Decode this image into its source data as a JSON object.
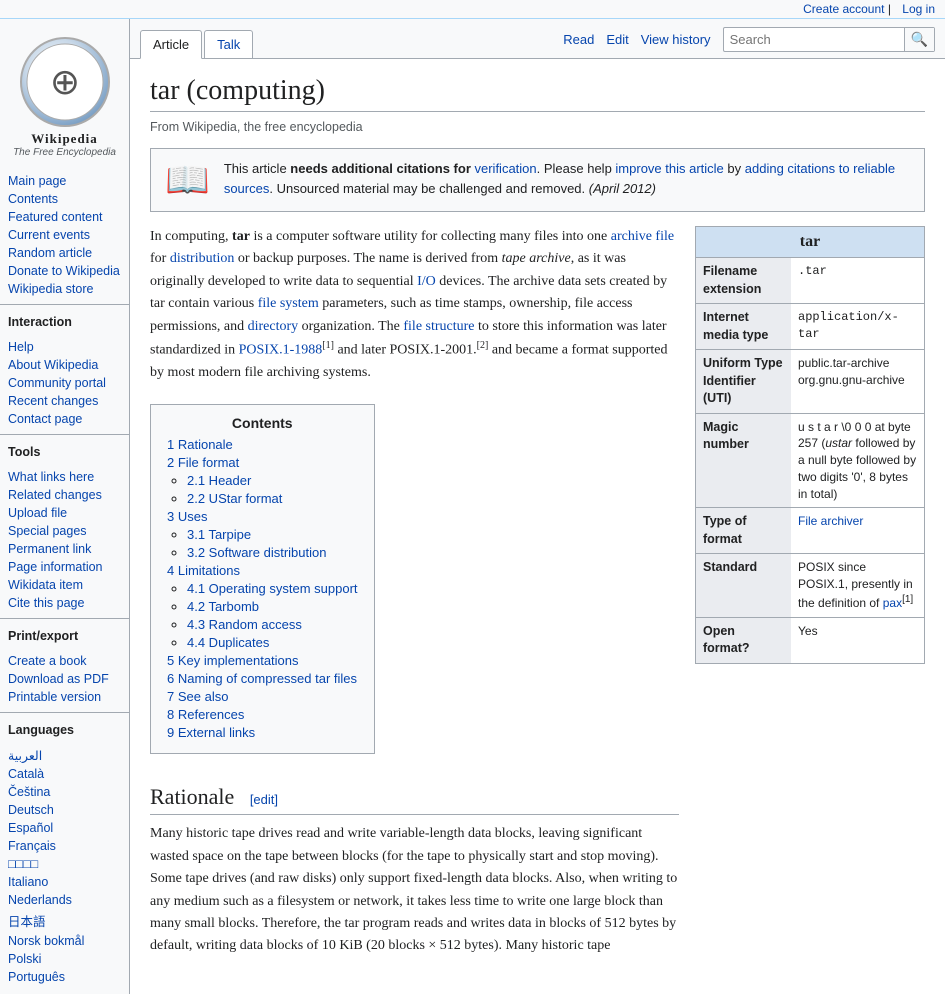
{
  "topbar": {
    "create_account": "Create account",
    "log_in": "Log in"
  },
  "logo": {
    "title": "Wikipedia",
    "subtitle": "The Free Encyclopedia",
    "icon": "🌐"
  },
  "sidebar": {
    "nav_items": [
      {
        "id": "main-page",
        "label": "Main page"
      },
      {
        "id": "contents",
        "label": "Contents"
      },
      {
        "id": "featured-content",
        "label": "Featured content"
      },
      {
        "id": "current-events",
        "label": "Current events"
      },
      {
        "id": "random-article",
        "label": "Random article"
      },
      {
        "id": "donate",
        "label": "Donate to Wikipedia"
      },
      {
        "id": "wikipedia-store",
        "label": "Wikipedia store"
      }
    ],
    "interaction_heading": "Interaction",
    "interaction_items": [
      {
        "id": "help",
        "label": "Help"
      },
      {
        "id": "about",
        "label": "About Wikipedia"
      },
      {
        "id": "community",
        "label": "Community portal"
      },
      {
        "id": "recent-changes",
        "label": "Recent changes"
      },
      {
        "id": "contact",
        "label": "Contact page"
      }
    ],
    "tools_heading": "Tools",
    "tools_items": [
      {
        "id": "what-links-here",
        "label": "What links here"
      },
      {
        "id": "related-changes",
        "label": "Related changes"
      },
      {
        "id": "upload-file",
        "label": "Upload file"
      },
      {
        "id": "special-pages",
        "label": "Special pages"
      },
      {
        "id": "permanent-link",
        "label": "Permanent link"
      },
      {
        "id": "page-info",
        "label": "Page information"
      },
      {
        "id": "wikidata-item",
        "label": "Wikidata item"
      },
      {
        "id": "cite-page",
        "label": "Cite this page"
      }
    ],
    "print_heading": "Print/export",
    "print_items": [
      {
        "id": "create-book",
        "label": "Create a book"
      },
      {
        "id": "download-pdf",
        "label": "Download as PDF"
      },
      {
        "id": "printable",
        "label": "Printable version"
      }
    ],
    "languages_heading": "Languages",
    "languages_items": [
      {
        "id": "lang-ar",
        "label": "العربية"
      },
      {
        "id": "lang-ca",
        "label": "Català"
      },
      {
        "id": "lang-cs",
        "label": "Čeština"
      },
      {
        "id": "lang-de",
        "label": "Deutsch"
      },
      {
        "id": "lang-es",
        "label": "Español"
      },
      {
        "id": "lang-fr",
        "label": "Français"
      },
      {
        "id": "lang-xx",
        "label": "□□□□"
      },
      {
        "id": "lang-it",
        "label": "Italiano"
      },
      {
        "id": "lang-nl",
        "label": "Nederlands"
      },
      {
        "id": "lang-ja",
        "label": "日本語"
      },
      {
        "id": "lang-no",
        "label": "Norsk bokmål"
      },
      {
        "id": "lang-pl",
        "label": "Polski"
      },
      {
        "id": "lang-pt",
        "label": "Português"
      }
    ]
  },
  "tabs": {
    "article": "Article",
    "talk": "Talk",
    "read": "Read",
    "edit": "Edit",
    "view_history": "View history"
  },
  "search": {
    "placeholder": "Search",
    "button_icon": "🔍"
  },
  "page": {
    "title": "tar (computing)",
    "subtitle": "From Wikipedia, the free encyclopedia",
    "notice": {
      "icon": "📖",
      "text_before_bold": "This article ",
      "bold_text": "needs additional citations for",
      "link_text": "verification",
      "text_after_link": ". Please help",
      "improve_link": "improve this article",
      "text2": "by adding citations to reliable sources",
      "text3": ". Unsourced material may be challenged and removed.",
      "date": "(April 2012)"
    },
    "intro": "In computing, tar is a computer software utility for collecting many files into one archive file for distribution or backup purposes. The name is derived from tape archive, as it was originally developed to write data to sequential I/O devices. The archive data sets created by tar contain various file system parameters, such as time stamps, ownership, file access permissions, and directory organization. The file structure to store this information was later standardized in POSIX.1-1988[1] and later POSIX.1-2001.[2] and became a format supported by most modern file archiving systems.",
    "contents": {
      "title": "Contents",
      "items": [
        {
          "num": "1",
          "label": "Rationale",
          "href": "#rationale"
        },
        {
          "num": "2",
          "label": "File format",
          "href": "#file-format",
          "sub": [
            {
              "num": "2.1",
              "label": "Header",
              "href": "#header"
            },
            {
              "num": "2.2",
              "label": "UStar format",
              "href": "#ustar"
            }
          ]
        },
        {
          "num": "3",
          "label": "Uses",
          "href": "#uses",
          "sub": [
            {
              "num": "3.1",
              "label": "Tarpipe",
              "href": "#tarpipe"
            },
            {
              "num": "3.2",
              "label": "Software distribution",
              "href": "#software-dist"
            }
          ]
        },
        {
          "num": "4",
          "label": "Limitations",
          "href": "#limitations",
          "sub": [
            {
              "num": "4.1",
              "label": "Operating system support",
              "href": "#os-support"
            },
            {
              "num": "4.2",
              "label": "Tarbomb",
              "href": "#tarbomb"
            },
            {
              "num": "4.3",
              "label": "Random access",
              "href": "#random-access"
            },
            {
              "num": "4.4",
              "label": "Duplicates",
              "href": "#duplicates"
            }
          ]
        },
        {
          "num": "5",
          "label": "Key implementations",
          "href": "#key-impl"
        },
        {
          "num": "6",
          "label": "Naming of compressed tar files",
          "href": "#naming"
        },
        {
          "num": "7",
          "label": "See also",
          "href": "#see-also"
        },
        {
          "num": "8",
          "label": "References",
          "href": "#references"
        },
        {
          "num": "9",
          "label": "External links",
          "href": "#external"
        }
      ]
    },
    "infobox": {
      "title": "tar",
      "rows": [
        {
          "label": "Filename extension",
          "value": ".tar",
          "mono": true
        },
        {
          "label": "Internet media type",
          "value": "application/x-tar",
          "mono": true
        },
        {
          "label": "Uniform Type Identifier (UTI)",
          "value": "public.tar-archive org.gnu.gnu-archive",
          "mono": false
        },
        {
          "label": "Magic number",
          "value": "u s t a r \\0 0 0 at byte 257 (ustar followed by a null byte followed by two digits '0', 8 bytes in total)",
          "mono": false
        },
        {
          "label": "Type of format",
          "value": "File archiver",
          "mono": false,
          "link": true
        },
        {
          "label": "Standard",
          "value": "POSIX since POSIX.1, presently in the definition of pax[1]",
          "mono": false
        },
        {
          "label": "Open format?",
          "value": "Yes",
          "mono": false
        }
      ]
    },
    "rationale": {
      "heading": "Rationale",
      "edit_label": "[edit]",
      "text": "Many historic tape drives read and write variable-length data blocks, leaving significant wasted space on the tape between blocks (for the tape to physically start and stop moving). Some tape drives (and raw disks) only support fixed-length data blocks. Also, when writing to any medium such as a filesystem or network, it takes less time to write one large block than many small blocks. Therefore, the tar program reads and writes data in blocks of 512 bytes by default, writing data blocks of 10 KiB (20 blocks × 512 bytes). Many historic tape"
    }
  }
}
